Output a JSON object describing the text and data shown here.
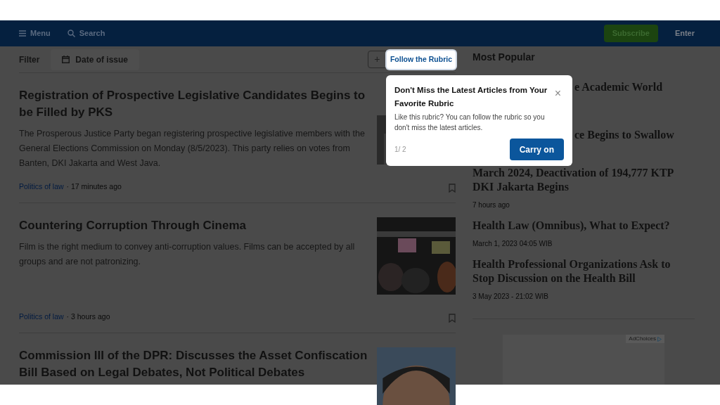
{
  "nav": {
    "menu": "Menu",
    "search": "Search",
    "subscribe": "Subscribe",
    "enter": "Enter"
  },
  "filter": {
    "label": "Filter",
    "date_button": "Date of issue",
    "follow_plus": "+",
    "follow_button": "Follow the Rubric"
  },
  "articles": [
    {
      "title": "Registration of Prospective Legislative Candidates Begins to be Filled by PKS",
      "summary": "The Prosperous Justice Party began registering prospective legislative members with the General Elections Commission on Monday (8/5/2023). This party relies on votes from Banten, DKI Jakarta and West Java.",
      "rubric": "Politics of law",
      "time": "· 17 minutes ago"
    },
    {
      "title": "Countering Corruption Through Cinema",
      "summary": "Film is the right medium to convey anti-corruption values. Films can be accepted by all groups and are not patronizing.",
      "rubric": "Politics of law",
      "time": "· 3 hours ago"
    },
    {
      "title": "Commission III of the DPR: Discusses the Asset Confiscation Bill Based on Legal Debates, Not Political Debates"
    }
  ],
  "popular": {
    "title": "Most Popular",
    "items": [
      {
        "kind": "covered",
        "title": "e Academic World"
      },
      {
        "kind": "covered",
        "title": "ce Begins to Swallow"
      },
      {
        "kind": "full",
        "title": "March 2024, Deactivation of 194,777 KTP DKI Jakarta Begins",
        "time": "7 hours ago"
      },
      {
        "kind": "full",
        "title": "Health Law (Omnibus), What to Expect?",
        "time": "March 1, 2023 04:05 WIB"
      },
      {
        "kind": "full",
        "title": "Health Professional Organizations Ask to Stop Discussion on the Health Bill",
        "time": "3 May 2023 - 21:02 WIB"
      }
    ]
  },
  "ad": {
    "label": "AdChoices"
  },
  "tour": {
    "title": "Don't Miss the Latest Articles from Your Favorite Rubric",
    "body": "Like this rubric? You can follow the rubric so you don't miss the latest articles.",
    "step": "1/ 2",
    "button": "Carry on",
    "close": "×"
  }
}
